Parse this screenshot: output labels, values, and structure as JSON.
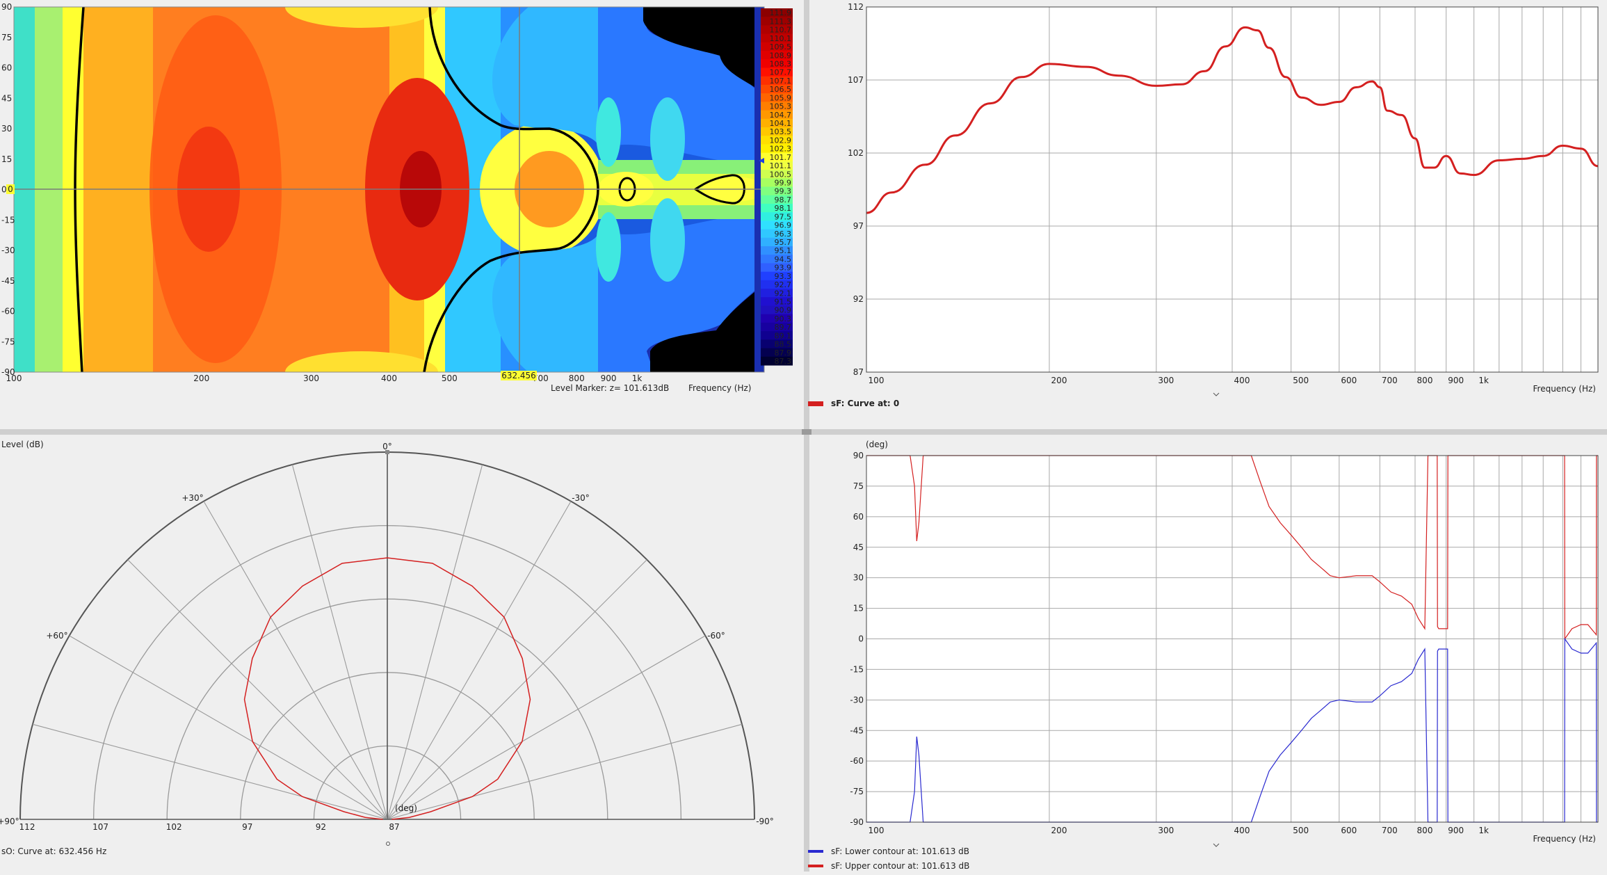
{
  "colors": {
    "background": "#efefef",
    "plot_bg": "#ffffff",
    "grid": "#a0a0a0",
    "divider": "#c9c9c9",
    "red_curve": "#d42020",
    "blue_curve": "#2a2ad0",
    "contour": "#000000",
    "highlight": "#ffff33"
  },
  "contour_panel": {
    "y_ticks": [
      "90",
      "75",
      "60",
      "45",
      "30",
      "15",
      "0",
      "-15",
      "-30",
      "-45",
      "-60",
      "-75",
      "-90"
    ],
    "zero_marker_label": "0",
    "x_ticks": [
      "100",
      "200",
      "300",
      "400",
      "500",
      "700",
      "800",
      "900",
      "1k"
    ],
    "cursor_label": "632.456",
    "level_marker_text": "Level Marker:  z= 101.613dB",
    "frequency_label": "Frequency  (Hz)",
    "colorscale": [
      "111.9",
      "111.3",
      "110.7",
      "110.1",
      "109.5",
      "108.9",
      "108.3",
      "107.7",
      "107.1",
      "106.5",
      "105.9",
      "105.3",
      "104.7",
      "104.1",
      "103.5",
      "102.9",
      "102.3",
      "101.7",
      "101.1",
      "100.5",
      "99.9",
      "99.3",
      "98.7",
      "98.1",
      "97.5",
      "96.9",
      "96.3",
      "95.7",
      "95.1",
      "94.5",
      "93.9",
      "93.3",
      "92.7",
      "92.1",
      "91.5",
      "90.9",
      "90.3",
      "89.7",
      "89.1",
      "88.5",
      "87.9",
      "87.3"
    ]
  },
  "polar_panel": {
    "ylabel": "Level  (dB)",
    "angle_labels": {
      "top": "0°",
      "p30": "+30°",
      "n30": "-30°",
      "p60": "+60°",
      "n60": "-60°",
      "p90": "+90°",
      "n90": "-90°"
    },
    "ring_labels": [
      "112",
      "107",
      "102",
      "97",
      "92",
      "87"
    ],
    "xlabel": "(deg)",
    "legend": "sO: Curve at: 632.456 Hz"
  },
  "chart_data": [
    {
      "type": "line",
      "title": "",
      "xlabel": "Frequency  (Hz)",
      "ylabel": "",
      "x_scale": "log",
      "xlim": [
        100,
        1600
      ],
      "ylim": [
        87,
        112
      ],
      "y_ticks": [
        "112",
        "107",
        "102",
        "97",
        "92",
        "87"
      ],
      "x_ticks": [
        "100",
        "200",
        "300",
        "400",
        "500",
        "600",
        "700",
        "800",
        "900",
        "1k"
      ],
      "series": [
        {
          "name": "sF: Curve at: 0",
          "x": [
            100,
            110,
            125,
            140,
            160,
            180,
            200,
            230,
            260,
            300,
            330,
            360,
            390,
            420,
            440,
            460,
            490,
            520,
            560,
            600,
            640,
            680,
            700,
            720,
            760,
            800,
            830,
            860,
            900,
            950,
            1000,
            1100,
            1200,
            1300,
            1400,
            1500,
            1600
          ],
          "y": [
            97.9,
            99.3,
            101.2,
            103.2,
            105.4,
            107.2,
            108.1,
            107.9,
            107.3,
            106.6,
            106.7,
            107.6,
            109.3,
            110.6,
            110.4,
            109.2,
            107.2,
            105.8,
            105.3,
            105.5,
            106.5,
            106.9,
            106.5,
            104.9,
            104.6,
            103.0,
            101.0,
            101.0,
            101.8,
            100.6,
            100.5,
            101.5,
            101.6,
            101.8,
            102.5,
            102.3,
            101.1
          ]
        }
      ]
    },
    {
      "type": "line",
      "title": "",
      "xlabel": "Frequency  (Hz)",
      "ylabel": "(deg)",
      "x_scale": "log",
      "xlim": [
        100,
        1600
      ],
      "ylim": [
        -90,
        90
      ],
      "y_ticks": [
        "90",
        "75",
        "60",
        "45",
        "30",
        "15",
        "0",
        "-15",
        "-30",
        "-45",
        "-60",
        "-75",
        "-90"
      ],
      "x_ticks": [
        "100",
        "200",
        "300",
        "400",
        "500",
        "600",
        "700",
        "800",
        "900",
        "1k"
      ],
      "series": [
        {
          "name": "sF: Lower contour at: 101.613 dB",
          "x": [
            100,
            118,
            120,
            121,
            122,
            124,
            125,
            126,
            128,
            130,
            430,
            445,
            460,
            480,
            500,
            520,
            540,
            560,
            580,
            600,
            640,
            660,
            680,
            700,
            730,
            760,
            790,
            810,
            830,
            840,
            841,
            870,
            871,
            875,
            880,
            905,
            906,
            1410,
            1411,
            1450,
            1500,
            1540,
            1580,
            1590,
            1591,
            1600
          ],
          "y": [
            -90,
            -90,
            -75,
            -48,
            -57,
            -90,
            -90,
            -90,
            -90,
            -90,
            -90,
            -77,
            -65,
            -57,
            -51,
            -45,
            -39,
            -35,
            -31,
            -30,
            -31,
            -31,
            -31,
            -28,
            -23,
            -21,
            -17,
            -10,
            -5,
            -90,
            -90,
            -90,
            -6,
            -5,
            -5,
            -5,
            -90,
            -90,
            0,
            -5,
            -7,
            -7,
            -3,
            -2,
            -90,
            -90
          ]
        },
        {
          "name": "sF: Upper contour at: 101.613 dB",
          "x": [
            100,
            118,
            120,
            121,
            122,
            124,
            125,
            126,
            128,
            130,
            430,
            445,
            460,
            480,
            500,
            520,
            540,
            560,
            580,
            600,
            640,
            660,
            680,
            700,
            730,
            760,
            790,
            810,
            830,
            840,
            841,
            870,
            871,
            875,
            880,
            905,
            906,
            1410,
            1411,
            1450,
            1500,
            1540,
            1580,
            1590,
            1591,
            1600
          ],
          "y": [
            90,
            90,
            75,
            48,
            57,
            90,
            90,
            90,
            90,
            90,
            90,
            77,
            65,
            57,
            51,
            45,
            39,
            35,
            31,
            30,
            31,
            31,
            31,
            28,
            23,
            21,
            17,
            10,
            5,
            90,
            90,
            90,
            6,
            5,
            5,
            5,
            90,
            90,
            0,
            5,
            7,
            7,
            3,
            2,
            90,
            90
          ]
        }
      ]
    },
    {
      "type": "heatmap",
      "title": "",
      "xlabel": "Frequency  (Hz)",
      "ylabel": "",
      "x_scale": "log",
      "xlim": [
        100,
        1600
      ],
      "ylim": [
        -90,
        90
      ],
      "zlim": [
        87.3,
        111.9
      ],
      "contour_level": 101.613,
      "cursor_x": 632.456
    },
    {
      "type": "scatter",
      "polar": true,
      "title": "",
      "xlabel": "(deg)",
      "ylabel": "Level  (dB)",
      "rlim": [
        87,
        112
      ],
      "series": [
        {
          "name": "sO: Curve at: 632.456 Hz",
          "theta": [
            -90,
            -85,
            -80,
            -75,
            -70,
            -60,
            -50,
            -40,
            -30,
            -20,
            -10,
            0,
            10,
            20,
            30,
            40,
            50,
            60,
            70,
            75,
            80,
            85,
            90
          ],
          "r": [
            87.3,
            88.5,
            90,
            93,
            95,
            97.6,
            99.7,
            101.3,
            102.9,
            103.9,
            104.7,
            104.8,
            104.7,
            103.9,
            102.9,
            101.3,
            99.7,
            97.6,
            95,
            93,
            90,
            88.5,
            87.3
          ]
        }
      ]
    }
  ]
}
